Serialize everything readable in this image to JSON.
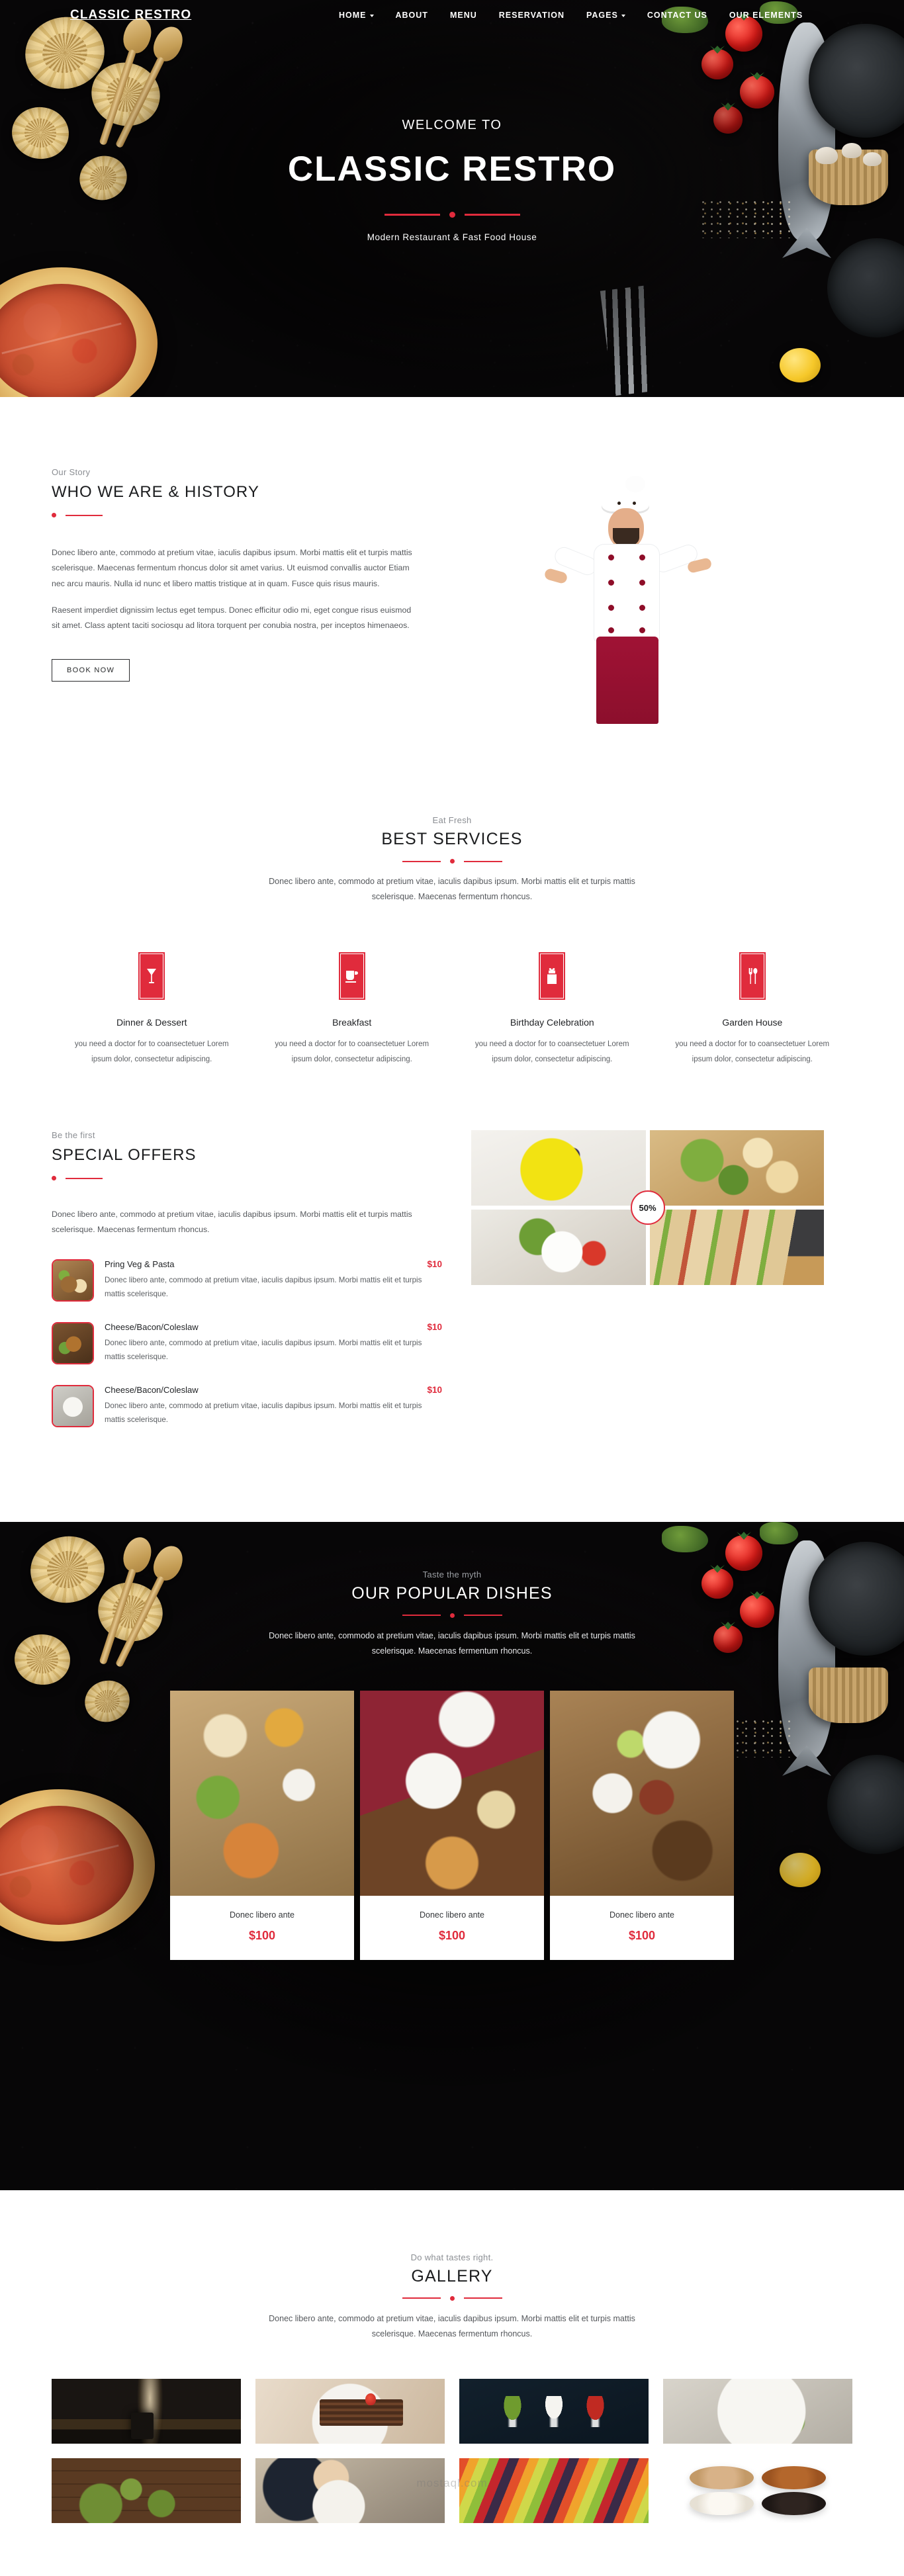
{
  "brand": "CLASSIC RESTRO",
  "nav": [
    {
      "label": "HOME",
      "caret": true
    },
    {
      "label": "ABOUT",
      "caret": false
    },
    {
      "label": "MENU",
      "caret": false
    },
    {
      "label": "RESERVATION",
      "caret": false
    },
    {
      "label": "PAGES",
      "caret": true
    },
    {
      "label": "CONTACT US",
      "caret": false
    },
    {
      "label": "OUR ELEMENTS",
      "caret": false
    }
  ],
  "hero": {
    "welcome": "WELCOME TO",
    "title": "CLASSIC RESTRO",
    "tagline": "Modern Restaurant & Fast Food House"
  },
  "story": {
    "kicker": "Our Story",
    "title": "WHO WE ARE & HISTORY",
    "p1": "Donec libero ante, commodo at pretium vitae, iaculis dapibus ipsum. Morbi mattis elit et turpis mattis scelerisque. Maecenas fermentum rhoncus dolor sit amet varius. Ut euismod convallis auctor Etiam nec arcu mauris. Nulla id nunc et libero mattis tristique at in quam. Fusce quis risus mauris.",
    "p2": "Raesent imperdiet dignissim lectus eget tempus. Donec efficitur odio mi, eget congue risus euismod sit amet. Class aptent taciti sociosqu ad litora torquent per conubia nostra, per inceptos himenaeos.",
    "cta": "BOOK NOW"
  },
  "services": {
    "kicker": "Eat Fresh",
    "title": "BEST SERVICES",
    "subtitle": "Donec libero ante, commodo at pretium vitae, iaculis dapibus ipsum. Morbi mattis elit et turpis mattis scelerisque. Maecenas fermentum rhoncus.",
    "items": [
      {
        "icon": "cocktail-glass-icon",
        "name": "Dinner & Dessert",
        "text": "you need a doctor for to coansectetuer Lorem ipsum dolor, consectetur adipiscing."
      },
      {
        "icon": "coffee-cup-icon",
        "name": "Breakfast",
        "text": "you need a doctor for to coansectetuer Lorem ipsum dolor, consectetur adipiscing."
      },
      {
        "icon": "gift-box-icon",
        "name": "Birthday Celebration",
        "text": "you need a doctor for to coansectetuer Lorem ipsum dolor, consectetur adipiscing."
      },
      {
        "icon": "fork-spoon-icon",
        "name": "Garden House",
        "text": "you need a doctor for to coansectetuer Lorem ipsum dolor, consectetur adipiscing."
      }
    ]
  },
  "offers": {
    "kicker": "Be the first",
    "title": "SPECIAL OFFERS",
    "intro": "Donec libero ante, commodo at pretium vitae, iaculis dapibus ipsum. Morbi mattis elit et turpis mattis scelerisque. Maecenas fermentum rhoncus.",
    "badge": "50%",
    "items": [
      {
        "name": "Pring Veg & Pasta",
        "price": "$10",
        "desc": "Donec libero ante, commodo at pretium vitae, iaculis dapibus ipsum. Morbi mattis elit et turpis mattis scelerisque.",
        "thumb": "steak-and-fries-photo"
      },
      {
        "name": "Cheese/Bacon/Coleslaw",
        "price": "$10",
        "desc": "Donec libero ante, commodo at pretium vitae, iaculis dapibus ipsum. Morbi mattis elit et turpis mattis scelerisque.",
        "thumb": "fried-chicken-photo"
      },
      {
        "name": "Cheese/Bacon/Coleslaw",
        "price": "$10",
        "desc": "Donec libero ante, commodo at pretium vitae, iaculis dapibus ipsum. Morbi mattis elit et turpis mattis scelerisque.",
        "thumb": "roast-chicken-plate-photo"
      }
    ],
    "mosaic": [
      {
        "name": "yellow-bowl-granola-photo"
      },
      {
        "name": "caesar-salad-photo"
      },
      {
        "name": "shrimp-rice-plate-photo"
      },
      {
        "name": "club-sandwich-board-photo"
      }
    ]
  },
  "popular": {
    "kicker": "Taste the myth",
    "title": "OUR POPULAR DISHES",
    "subtitle": "Donec libero ante, commodo at pretium vitae, iaculis dapibus ipsum. Morbi mattis elit et turpis mattis scelerisque. Maecenas fermentum rhoncus.",
    "dishes": [
      {
        "name": "Donec libero ante",
        "price": "$100",
        "image": "japanese-set-meal-photo"
      },
      {
        "name": "Donec libero ante",
        "price": "$100",
        "image": "shared-table-spread-photo"
      },
      {
        "name": "Donec libero ante",
        "price": "$100",
        "image": "asian-dinner-table-photo"
      }
    ]
  },
  "gallery": {
    "kicker": "Do what tastes right.",
    "title": "GALLERY",
    "subtitle": "Donec libero ante, commodo at pretium vitae, iaculis dapibus ipsum. Morbi mattis elit et turpis mattis scelerisque. Maecenas fermentum rhoncus.",
    "row1": [
      {
        "name": "steaming-pot-photo"
      },
      {
        "name": "chocolate-cake-slice-photo"
      },
      {
        "name": "three-spoons-spices-photo"
      },
      {
        "name": "avocado-egg-toast-photo"
      }
    ],
    "row2": [
      {
        "name": "matcha-bowls-photo"
      },
      {
        "name": "people-dining-photo"
      },
      {
        "name": "fruit-market-photo"
      },
      {
        "name": "four-donuts-photo"
      }
    ],
    "watermark": "mostaql.com"
  },
  "colors": {
    "accent": "#e02b3c",
    "dark": "#0a0809",
    "heading": "#1b1c1e",
    "body": "#55585c",
    "muted": "#8b8e93"
  }
}
